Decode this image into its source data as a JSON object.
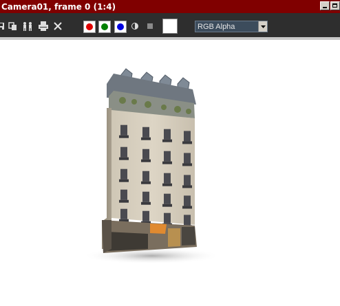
{
  "window": {
    "title": "Camera01, frame 0 (1:4)"
  },
  "toolbar": {
    "channel_dropdown": {
      "selected": "RGB Alpha"
    },
    "channels": [
      {
        "name": "red-channel",
        "color": "#e00000"
      },
      {
        "name": "green-channel",
        "color": "#008000"
      },
      {
        "name": "blue-channel",
        "color": "#0000e0"
      }
    ]
  },
  "icons": [
    "save-image-icon",
    "clone-window-icon",
    "enable-tracking-icon",
    "print-icon",
    "clear-icon",
    "red-channel-icon",
    "green-channel-icon",
    "blue-channel-icon",
    "monochrome-icon",
    "alpha-channel-icon",
    "background-color-swatch",
    "dropdown-arrow-icon"
  ],
  "colors": {
    "titlebar": "#800000",
    "toolbar": "#2e2e2e",
    "canvas": "#ffffff"
  }
}
